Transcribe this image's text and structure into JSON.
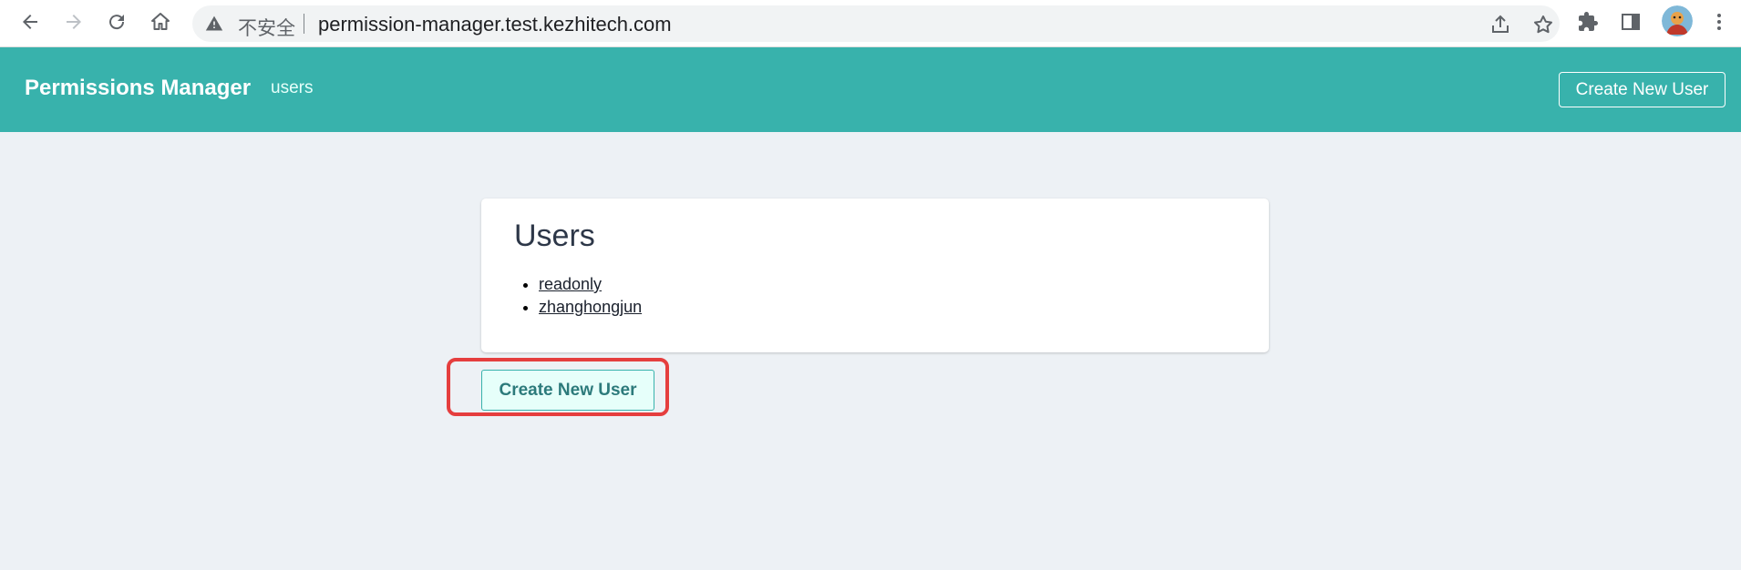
{
  "browser": {
    "security_label": "不安全",
    "url": "permission-manager.test.kezhitech.com"
  },
  "header": {
    "brand": "Permissions Manager",
    "nav_users": "users",
    "create_button": "Create New User"
  },
  "card": {
    "title": "Users",
    "users": [
      "readonly",
      "zhanghongjun"
    ]
  },
  "main": {
    "create_button": "Create New User"
  },
  "colors": {
    "header_bg": "#38b2ac",
    "page_bg": "#edf1f5",
    "highlight": "#e53e3e"
  }
}
